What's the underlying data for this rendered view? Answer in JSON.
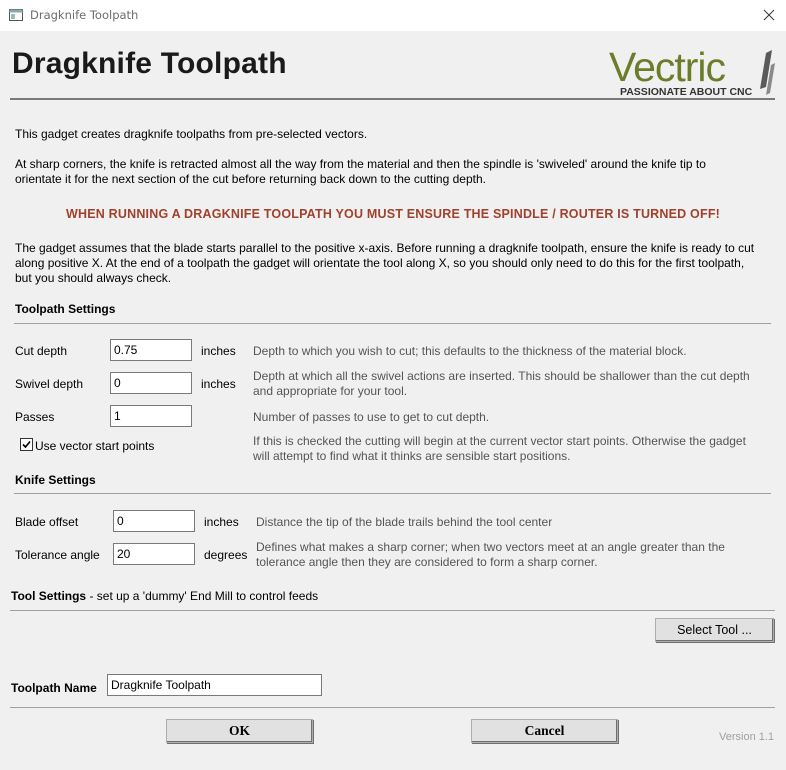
{
  "window": {
    "title": "Dragknife Toolpath"
  },
  "header": {
    "heading": "Dragknife Toolpath",
    "logo_text": "Vectric",
    "logo_tagline": "PASSIONATE ABOUT CNC"
  },
  "intro": {
    "line1": "This gadget creates dragknife toolpaths from pre-selected vectors.",
    "para2_l1": "At sharp corners, the knife is retracted almost all the way from the material and then the spindle is 'swiveled' around the knife tip to",
    "para2_l2": "orientate it for the next section of the cut before returning back down to the cutting depth.",
    "warning": "WHEN RUNNING A DRAGKNIFE TOOLPATH YOU MUST ENSURE THE SPINDLE / ROUTER IS TURNED OFF!",
    "para3_l1": "The gadget assumes that the blade starts parallel to the positive x-axis. Before running a dragknife toolpath, ensure the knife is ready to cut",
    "para3_l2": "along positive X. At the end of a toolpath the gadget will orientate the tool along X, so you should only need to do this for the first toolpath,",
    "para3_l3": "but you should always check."
  },
  "toolpath_settings": {
    "title": "Toolpath Settings",
    "cut_depth": {
      "label": "Cut depth",
      "value": "0.75",
      "unit": "inches",
      "desc": "Depth to which you wish to cut; this defaults to the thickness of the material block."
    },
    "swivel_depth": {
      "label": "Swivel depth",
      "value": "0",
      "unit": "inches",
      "desc_l1": "Depth at which all the swivel actions are inserted. This should be shallower than the cut depth",
      "desc_l2": "and appropriate for your tool."
    },
    "passes": {
      "label": "Passes",
      "value": "1",
      "desc": "Number of passes to use to get to cut depth."
    },
    "use_vector_start": {
      "label": "Use vector start points",
      "checked": true,
      "desc_l1": "If this is checked the cutting will begin at the current vector start points. Otherwise the gadget",
      "desc_l2": "will attempt to find what it thinks are sensible start positions."
    }
  },
  "knife_settings": {
    "title": "Knife Settings",
    "blade_offset": {
      "label": "Blade offset",
      "value": "0",
      "unit": "inches",
      "desc": "Distance the tip of the blade trails behind the tool center"
    },
    "tolerance_angle": {
      "label": "Tolerance angle",
      "value": "20",
      "unit": "degrees",
      "desc_l1": "Defines what makes a sharp corner; when two vectors meet at an angle greater than the",
      "desc_l2": "tolerance angle then they are considered to form a sharp corner."
    }
  },
  "tool_settings": {
    "title": "Tool Settings",
    "subtitle": " - set up a 'dummy' End Mill to control feeds",
    "select_button": "Select Tool ..."
  },
  "toolpath_name": {
    "label": "Toolpath Name",
    "value": "Dragknife Toolpath"
  },
  "footer": {
    "ok": "OK",
    "cancel": "Cancel",
    "version": "Version 1.1"
  },
  "colors": {
    "warning": "#a0412d",
    "logo_green": "#6b7d2a",
    "logo_grey": "#5a5a5a"
  }
}
